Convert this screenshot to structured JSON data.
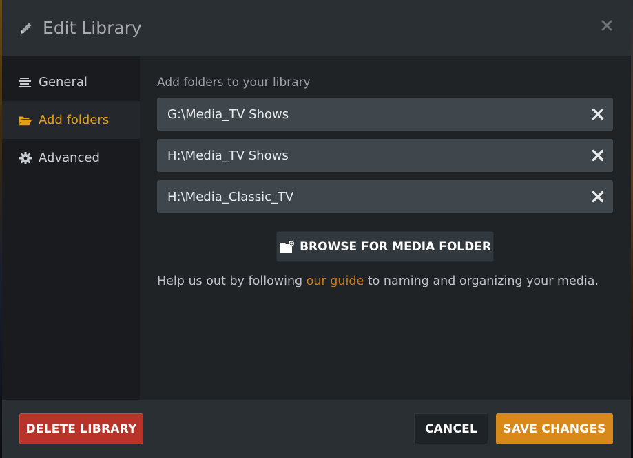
{
  "header": {
    "title": "Edit Library",
    "close_glyph": "✕"
  },
  "sidebar": {
    "items": [
      {
        "label": "General",
        "icon": "lines-icon",
        "active": false
      },
      {
        "label": "Add folders",
        "icon": "folder-open-icon",
        "active": true
      },
      {
        "label": "Advanced",
        "icon": "gear-icon",
        "active": false
      }
    ]
  },
  "main": {
    "section_label": "Add folders to your library",
    "folders": [
      {
        "path": "G:\\Media_TV Shows"
      },
      {
        "path": "H:\\Media_TV Shows"
      },
      {
        "path": "H:\\Media_Classic_TV"
      }
    ],
    "browse_label": "BROWSE FOR MEDIA FOLDER",
    "help": {
      "before": "Help us out by following ",
      "link": "our guide",
      "after": " to naming and organizing your media."
    }
  },
  "footer": {
    "delete_label": "DELETE LIBRARY",
    "cancel_label": "CANCEL",
    "save_label": "SAVE CHANGES"
  },
  "colors": {
    "accent": "#e5a00d",
    "link": "#cc7b19",
    "danger": "#b8332a",
    "save": "#d9891a"
  }
}
